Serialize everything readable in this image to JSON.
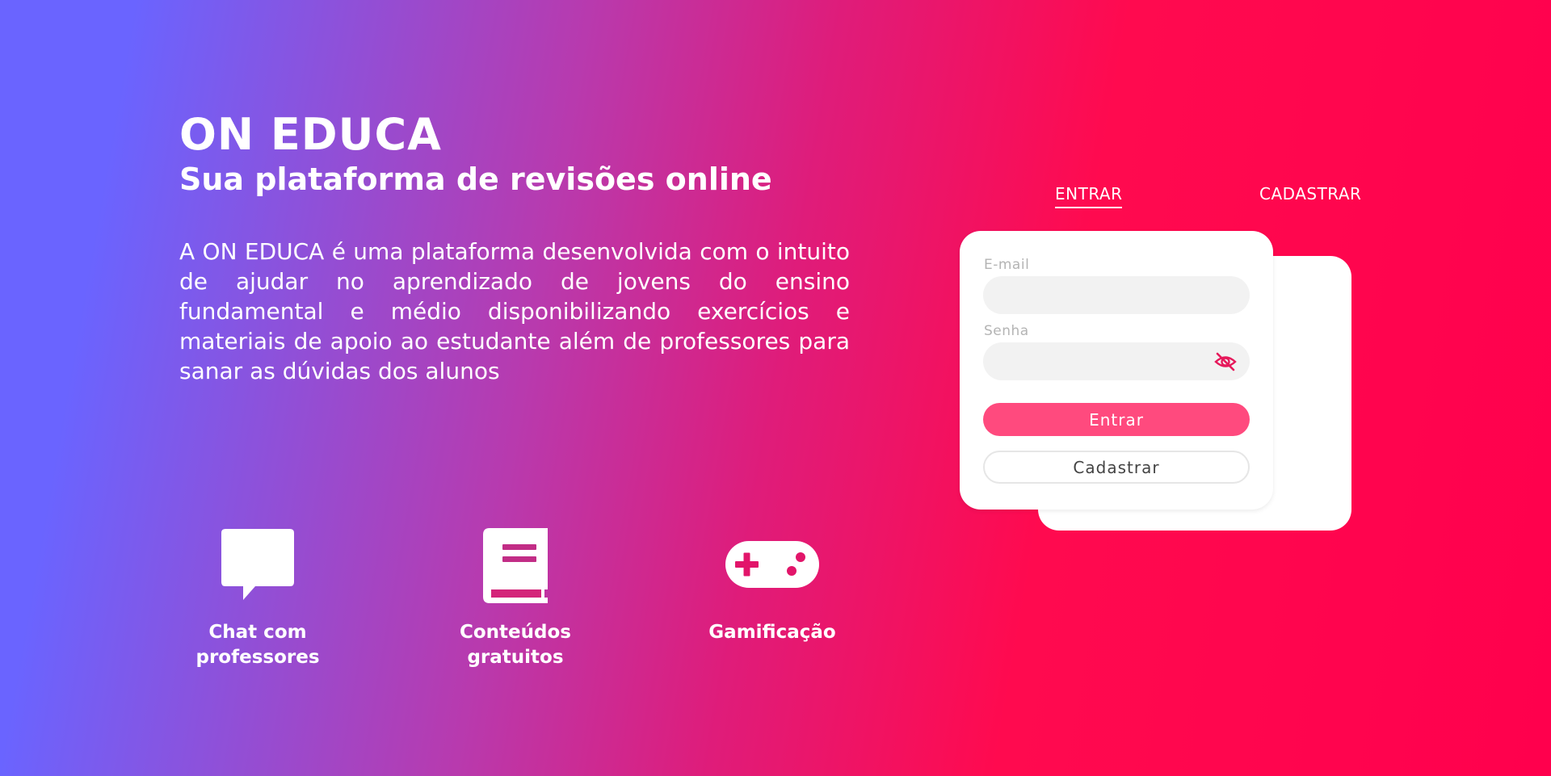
{
  "hero": {
    "title": "ON EDUCA",
    "subtitle": "Sua plataforma de revisões online",
    "description": "A ON EDUCA é uma plataforma desenvolvida com o intuito de ajudar no aprendizado de jovens do ensino fundamental e médio disponibilizando exercícios e materiais de apoio ao estudante além de professores para sanar as dúvidas dos alunos"
  },
  "features": [
    {
      "icon": "chat-icon",
      "label_line1": "Chat com",
      "label_line2": "professores"
    },
    {
      "icon": "book-icon",
      "label_line1": "Conteúdos",
      "label_line2": "gratuitos"
    },
    {
      "icon": "gamepad-icon",
      "label_line1": "Gamificação",
      "label_line2": ""
    }
  ],
  "tabs": {
    "entrar": "ENTRAR",
    "cadastrar": "CADASTRAR",
    "active": "ENTRAR"
  },
  "login_form": {
    "email_label": "E-mail",
    "email_value": "",
    "password_label": "Senha",
    "password_value": "",
    "password_toggle_icon": "eye-slash-icon",
    "submit_label": "Entrar",
    "register_label": "Cadastrar"
  },
  "colors": {
    "gradient_start": "#6a64ff",
    "gradient_end": "#ff004d",
    "primary_button": "#ff4a7e",
    "accent_icon": "#e6195b",
    "input_background": "#f2f2f2"
  }
}
